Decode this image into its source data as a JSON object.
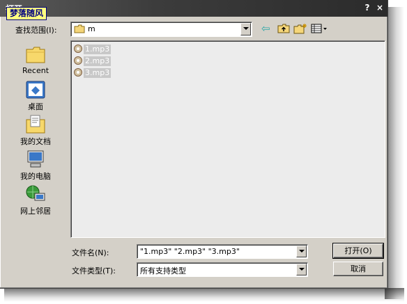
{
  "window": {
    "title": "打开",
    "help_glyph": "?",
    "close_glyph": "×",
    "watermark": "梦落随风"
  },
  "lookin": {
    "label": "查找范围(I):",
    "value": "m"
  },
  "toolbar": {
    "back_glyph": "⇦"
  },
  "places": [
    {
      "label": "Recent"
    },
    {
      "label": "桌面"
    },
    {
      "label": "我的文档"
    },
    {
      "label": "我的电脑"
    },
    {
      "label": "网上邻居"
    }
  ],
  "files": [
    {
      "name": "1.mp3"
    },
    {
      "name": "2.mp3"
    },
    {
      "name": "3.mp3"
    }
  ],
  "filename": {
    "label": "文件名(N):",
    "value": "\"1.mp3\" \"2.mp3\" \"3.mp3\""
  },
  "filetype": {
    "label": "文件类型(T):",
    "value": "所有支持类型"
  },
  "buttons": {
    "open": "打开(O)",
    "cancel": "取消"
  }
}
